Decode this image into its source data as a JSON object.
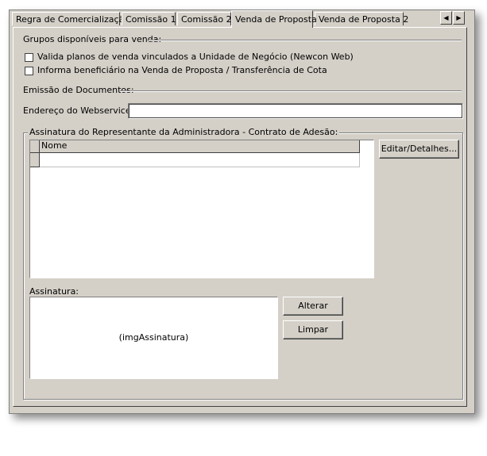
{
  "tabs": [
    {
      "label": "Regra de Comercialização"
    },
    {
      "label": "Comissão 1"
    },
    {
      "label": "Comissão 2"
    },
    {
      "label": "Venda de Proposta",
      "active": true
    },
    {
      "label": "Venda de Proposta 2"
    }
  ],
  "groups_section": {
    "title": "Grupos disponíveis para venda:",
    "checkbox1_label": "Valida planos de venda vinculados a Unidade de Negócio (Newcon Web)",
    "checkbox1_checked": false,
    "checkbox2_label": "Informa beneficiário na Venda de Proposta / Transferência de Cota",
    "checkbox2_checked": false
  },
  "documents_section": {
    "title": "Emissão de Documentos:",
    "webservice_label": "Endereço do Webservice:",
    "webservice_value": ""
  },
  "signature_group": {
    "title": "Assinatura do Representante da Administradora - Contrato de Adesão:",
    "grid_column": "Nome",
    "edit_button": "Editar/Detalhes...",
    "signature_label": "Assinatura:",
    "image_placeholder": "(imgAssinatura)",
    "change_button": "Alterar",
    "clear_button": "Limpar"
  }
}
